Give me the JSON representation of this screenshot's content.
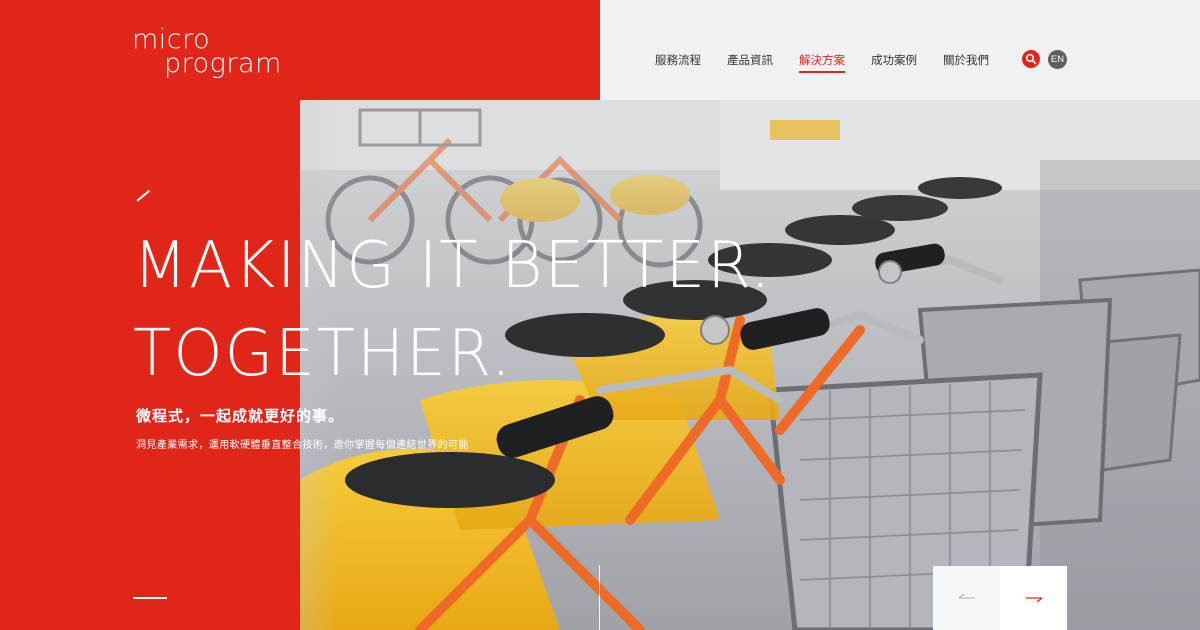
{
  "brand": {
    "logo_line1": "micro",
    "logo_line2": "program",
    "color_primary": "#e02619",
    "color_bg_light": "#f0f1f3"
  },
  "nav": {
    "items": [
      {
        "label": "服務流程",
        "active": false
      },
      {
        "label": "產品資訊",
        "active": false
      },
      {
        "label": "解決方案",
        "active": true
      },
      {
        "label": "成功案例",
        "active": false
      },
      {
        "label": "關於我們",
        "active": false
      }
    ],
    "search_icon": "search-icon",
    "lang_label": "EN"
  },
  "hero": {
    "headline_line1": "MAKING IT BETTER.",
    "headline_line2": "TOGETHER.",
    "subhead": "微程式，一起成就更好的事。",
    "description": "洞見產業需求，運用軟硬體垂直整合技術，邀你掌握每個連結世界的可能",
    "image_subject": "row of rental bicycles with baskets"
  },
  "slider": {
    "prev_icon": "arrow-left-icon",
    "next_icon": "arrow-right-icon"
  }
}
